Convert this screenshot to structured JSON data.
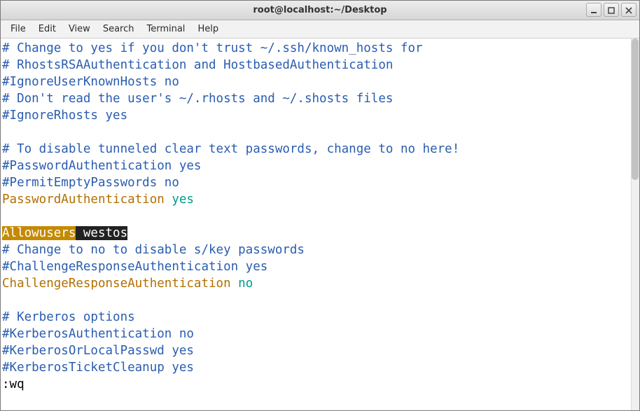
{
  "window": {
    "title": "root@localhost:~/Desktop"
  },
  "menu": {
    "items": [
      "File",
      "Edit",
      "View",
      "Search",
      "Terminal",
      "Help"
    ]
  },
  "editor": {
    "lines": [
      {
        "segments": [
          {
            "text": "# Change to yes if you don't trust ~/.ssh/known_hosts for",
            "cls": "c-comment"
          }
        ]
      },
      {
        "segments": [
          {
            "text": "# RhostsRSAAuthentication and HostbasedAuthentication",
            "cls": "c-comment"
          }
        ]
      },
      {
        "segments": [
          {
            "text": "#IgnoreUserKnownHosts no",
            "cls": "c-comment"
          }
        ]
      },
      {
        "segments": [
          {
            "text": "# Don't read the user's ~/.rhosts and ~/.shosts files",
            "cls": "c-comment"
          }
        ]
      },
      {
        "segments": [
          {
            "text": "#IgnoreRhosts yes",
            "cls": "c-comment"
          }
        ]
      },
      {
        "segments": [
          {
            "text": " ",
            "cls": ""
          }
        ]
      },
      {
        "segments": [
          {
            "text": "# To disable tunneled clear text passwords, change to no here!",
            "cls": "c-comment"
          }
        ]
      },
      {
        "segments": [
          {
            "text": "#PasswordAuthentication yes",
            "cls": "c-comment"
          }
        ]
      },
      {
        "segments": [
          {
            "text": "#PermitEmptyPasswords no",
            "cls": "c-comment"
          }
        ]
      },
      {
        "segments": [
          {
            "text": "PasswordAuthentication ",
            "cls": "c-key"
          },
          {
            "text": "yes",
            "cls": "c-val-yes"
          }
        ]
      },
      {
        "segments": [
          {
            "text": " ",
            "cls": ""
          }
        ]
      },
      {
        "segments": [
          {
            "text": "Allowusers",
            "cls": "hl-key"
          },
          {
            "text": " westos",
            "cls": "hl-val"
          }
        ]
      },
      {
        "segments": [
          {
            "text": "# Change to no to disable s/key passwords",
            "cls": "c-comment"
          }
        ]
      },
      {
        "segments": [
          {
            "text": "#ChallengeResponseAuthentication yes",
            "cls": "c-comment"
          }
        ]
      },
      {
        "segments": [
          {
            "text": "ChallengeResponseAuthentication ",
            "cls": "c-key"
          },
          {
            "text": "no",
            "cls": "c-val-no"
          }
        ]
      },
      {
        "segments": [
          {
            "text": " ",
            "cls": ""
          }
        ]
      },
      {
        "segments": [
          {
            "text": "# Kerberos options",
            "cls": "c-comment"
          }
        ]
      },
      {
        "segments": [
          {
            "text": "#KerberosAuthentication no",
            "cls": "c-comment"
          }
        ]
      },
      {
        "segments": [
          {
            "text": "#KerberosOrLocalPasswd yes",
            "cls": "c-comment"
          }
        ]
      },
      {
        "segments": [
          {
            "text": "#KerberosTicketCleanup yes",
            "cls": "c-comment"
          }
        ]
      },
      {
        "segments": [
          {
            "text": ":wq",
            "cls": "c-cmd"
          }
        ]
      }
    ]
  },
  "scrollbar": {
    "thumb_ratio_top": 0.0,
    "thumb_ratio_height": 0.38
  },
  "icons": {
    "minimize": "minimize-icon",
    "maximize": "maximize-icon",
    "close": "close-icon"
  }
}
